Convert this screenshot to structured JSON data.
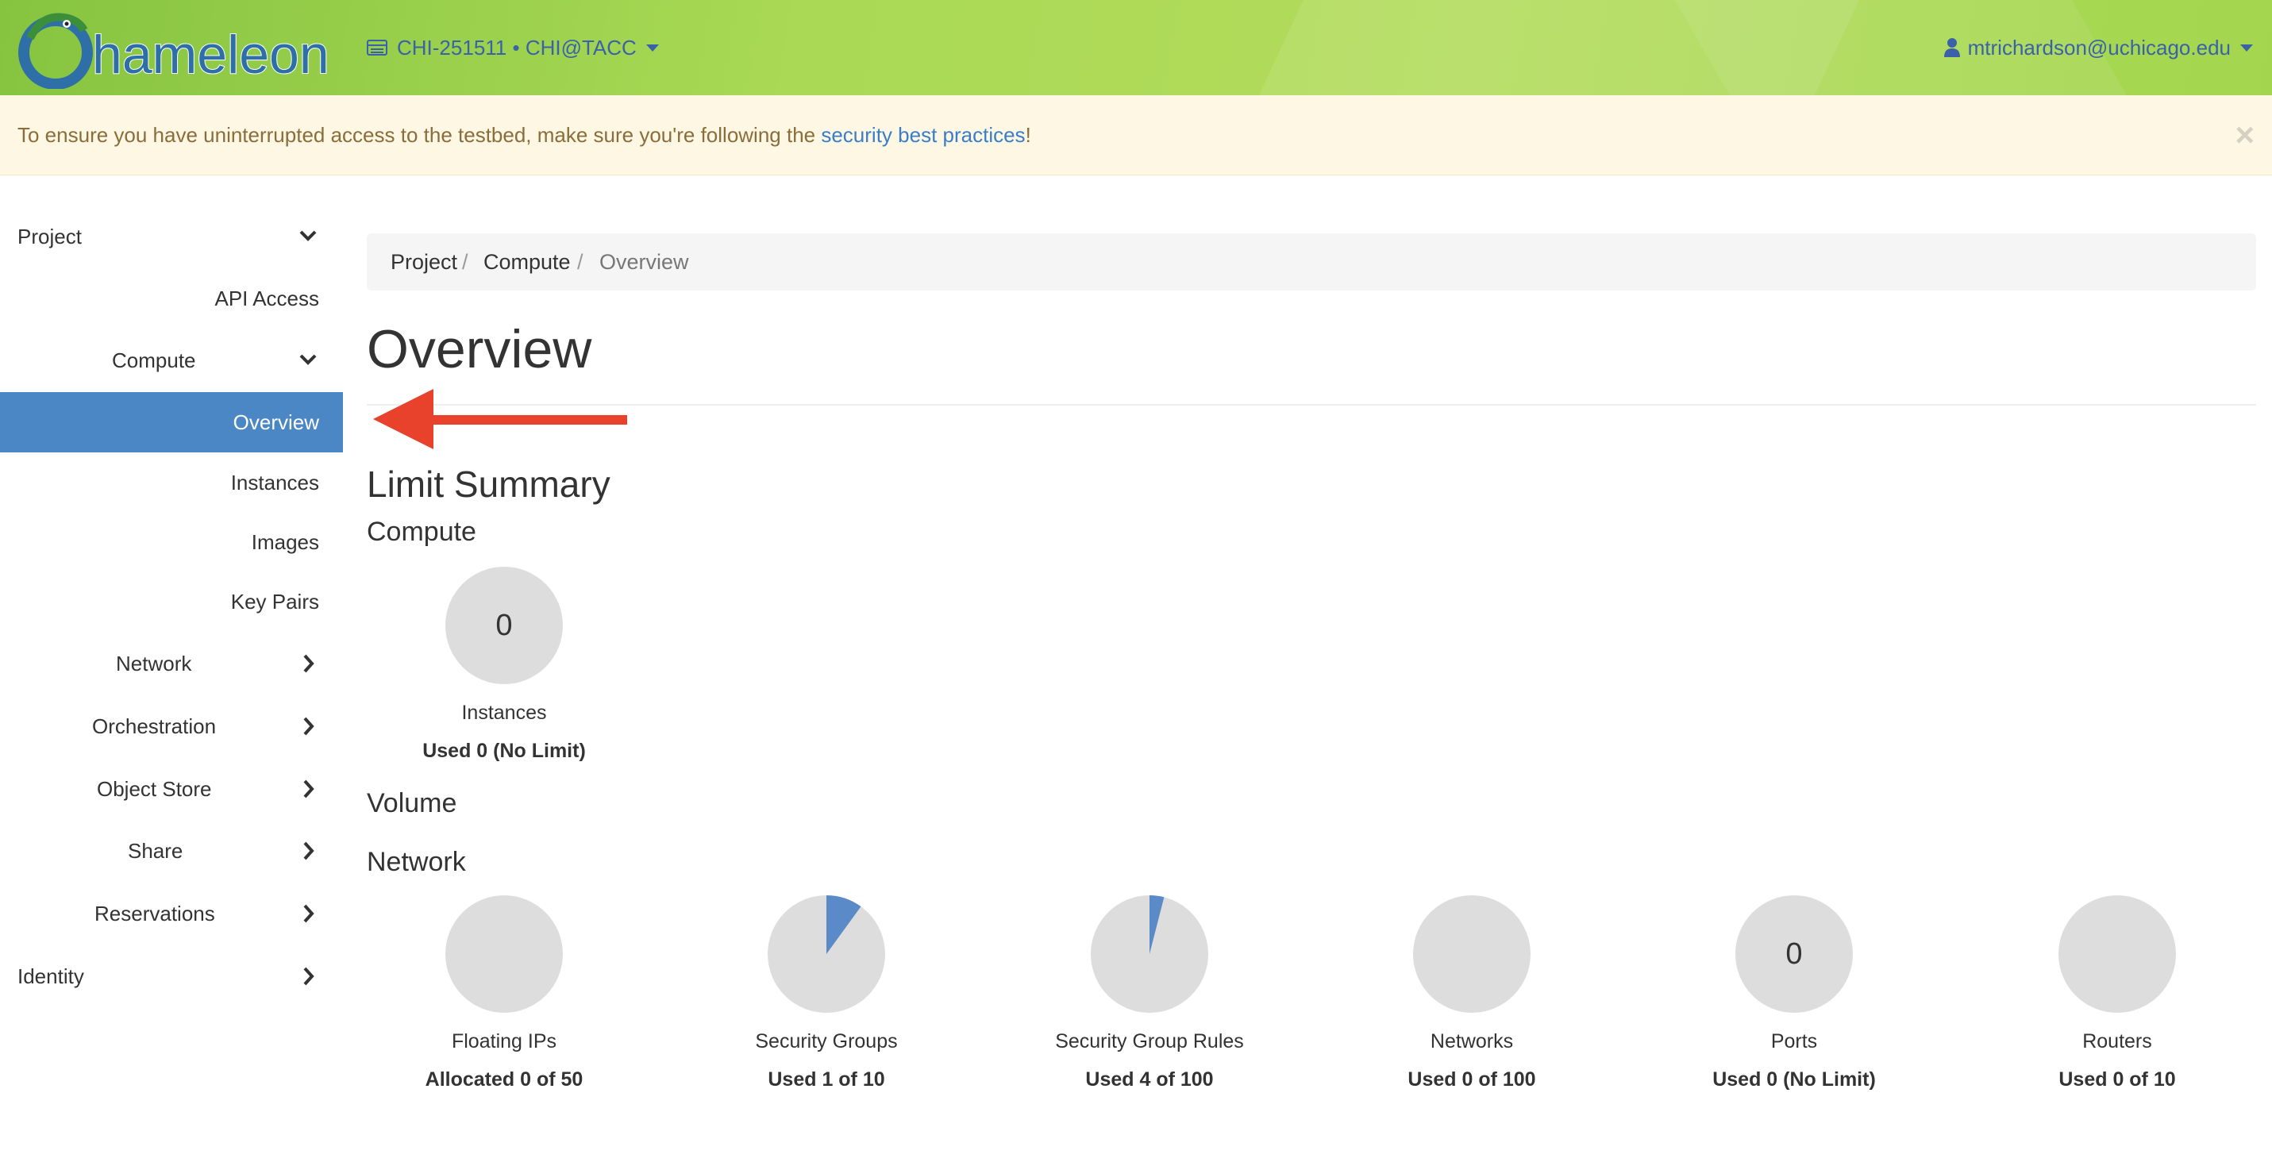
{
  "header": {
    "logo_text": "Chameleon",
    "project_switcher": "CHI-251511 • CHI@TACC",
    "user": "mtrichardson@uchicago.edu"
  },
  "alert": {
    "text_before": "To ensure you have uninterrupted access to the testbed, make sure you're following the ",
    "link": "security best practices",
    "text_after": "!",
    "close": "×"
  },
  "sidebar": {
    "project": "Project",
    "api_access": "API Access",
    "compute": "Compute",
    "overview": "Overview",
    "instances": "Instances",
    "images": "Images",
    "key_pairs": "Key Pairs",
    "network": "Network",
    "orchestration": "Orchestration",
    "object_store": "Object Store",
    "share": "Share",
    "reservations": "Reservations",
    "identity": "Identity"
  },
  "breadcrumb": {
    "project": "Project",
    "compute": "Compute",
    "current": "Overview",
    "separator": "/"
  },
  "main": {
    "title": "Overview",
    "limit_summary": "Limit Summary",
    "compute_heading": "Compute",
    "volume_heading": "Volume",
    "network_heading": "Network"
  },
  "compute_limits": [
    {
      "label": "Instances",
      "usage": "Used 0 (No Limit)",
      "count": "0",
      "fraction": 0
    }
  ],
  "network_limits": [
    {
      "label": "Floating IPs",
      "usage": "Allocated 0 of 50",
      "count": "",
      "fraction": 0
    },
    {
      "label": "Security Groups",
      "usage": "Used 1 of 10",
      "count": "",
      "fraction": 0.1
    },
    {
      "label": "Security Group Rules",
      "usage": "Used 4 of 100",
      "count": "",
      "fraction": 0.04
    },
    {
      "label": "Networks",
      "usage": "Used 0 of 100",
      "count": "",
      "fraction": 0
    },
    {
      "label": "Ports",
      "usage": "Used 0 (No Limit)",
      "count": "0",
      "fraction": 0
    },
    {
      "label": "Routers",
      "usage": "Used 0 of 10",
      "count": "",
      "fraction": 0
    }
  ],
  "colors": {
    "accent": "#4b86c5",
    "pie_bg": "#dddddd",
    "pie_fill": "#5b8ac9",
    "arrow": "#e8412c"
  }
}
